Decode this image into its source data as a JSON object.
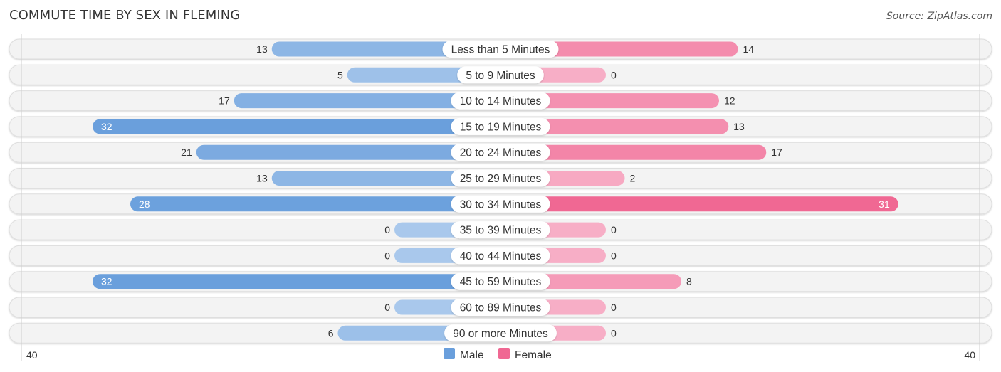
{
  "header": {
    "title": "COMMUTE TIME BY SEX IN FLEMING",
    "source": "Source: ZipAtlas.com"
  },
  "chart_data": {
    "type": "bar",
    "orientation": "horizontal-diverging",
    "title": "COMMUTE TIME BY SEX IN FLEMING",
    "categories": [
      "Less than 5 Minutes",
      "5 to 9 Minutes",
      "10 to 14 Minutes",
      "15 to 19 Minutes",
      "20 to 24 Minutes",
      "25 to 29 Minutes",
      "30 to 34 Minutes",
      "35 to 39 Minutes",
      "40 to 44 Minutes",
      "45 to 59 Minutes",
      "60 to 89 Minutes",
      "90 or more Minutes"
    ],
    "series": [
      {
        "name": "Male",
        "color": "#6a9fdc",
        "values": [
          13,
          5,
          17,
          32,
          21,
          13,
          28,
          0,
          0,
          32,
          0,
          6
        ]
      },
      {
        "name": "Female",
        "color": "#f06893",
        "values": [
          14,
          0,
          12,
          13,
          17,
          2,
          31,
          0,
          0,
          8,
          0,
          0
        ]
      }
    ],
    "axis": {
      "left_label": "40",
      "right_label": "40",
      "max": 40
    },
    "legend": {
      "position": "bottom-center",
      "items": [
        "Male",
        "Female"
      ]
    },
    "colors": {
      "male_strong": "#6a9fdc",
      "male_light": "#a9c8ec",
      "female_strong": "#f06893",
      "female_light": "#f7aec6",
      "row_background": "#f3f3f3"
    }
  }
}
